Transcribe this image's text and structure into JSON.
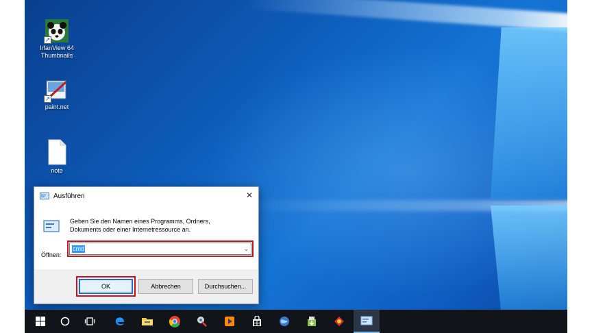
{
  "desktop": {
    "icons": [
      {
        "label_line1": "IrfanView 64",
        "label_line2": "Thumbnails",
        "icon": "irfanview-panda-icon"
      },
      {
        "label_line1": "paint.net",
        "label_line2": "",
        "icon": "paintnet-icon"
      },
      {
        "label_line1": "note",
        "label_line2": "",
        "icon": "text-file-icon"
      }
    ]
  },
  "run_dialog": {
    "title": "Ausführen",
    "close_glyph": "✕",
    "description": "Geben Sie den Namen eines Programms, Ordners, Dokuments oder einer Internetressource an.",
    "open_label": "Öffnen:",
    "input_value": "cmd",
    "ok_label": "OK",
    "cancel_label": "Abbrechen",
    "browse_label": "Durchsuchen...",
    "highlight_color": "#d0101c"
  },
  "taskbar": {
    "items": [
      {
        "icon": "windows-start-icon"
      },
      {
        "icon": "cortana-search-icon"
      },
      {
        "icon": "task-view-icon"
      },
      {
        "icon": "edge-browser-icon"
      },
      {
        "icon": "file-explorer-icon"
      },
      {
        "icon": "chrome-icon"
      },
      {
        "icon": "app-pinwheel-icon"
      },
      {
        "icon": "media-player-icon"
      },
      {
        "icon": "store-icon"
      },
      {
        "icon": "globe-app-icon"
      },
      {
        "icon": "installer-icon"
      },
      {
        "icon": "game-icon"
      },
      {
        "icon": "run-app-icon",
        "active": true
      }
    ]
  }
}
